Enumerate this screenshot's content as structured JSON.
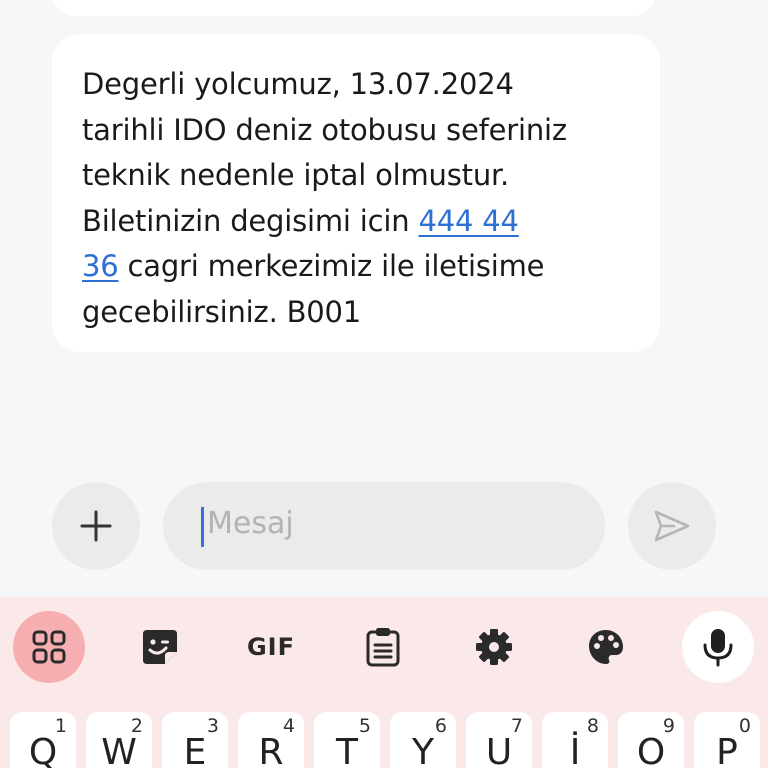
{
  "message": {
    "lines": [
      "Degerli yolcumuz, 13.07.2024",
      "tarihli IDO deniz otobusu seferiniz",
      "teknik nedenle iptal olmustur.",
      "Biletinizin degisimi icin ",
      "444 44",
      "36",
      " cagri merkezimiz ile iletisime",
      "gecebilirsiniz. B001"
    ]
  },
  "compose": {
    "placeholder": "Mesaj",
    "add_icon": "plus-icon",
    "send_icon": "send-icon"
  },
  "keyboard": {
    "toolbar": [
      {
        "name": "apps-grid-icon"
      },
      {
        "name": "sticker-icon"
      },
      {
        "name": "gif-button",
        "label": "GIF"
      },
      {
        "name": "clipboard-icon"
      },
      {
        "name": "settings-gear-icon"
      },
      {
        "name": "palette-icon"
      },
      {
        "name": "microphone-icon"
      }
    ],
    "keys": [
      {
        "letter": "Q",
        "num": "1"
      },
      {
        "letter": "W",
        "num": "2"
      },
      {
        "letter": "E",
        "num": "3"
      },
      {
        "letter": "R",
        "num": "4"
      },
      {
        "letter": "T",
        "num": "5"
      },
      {
        "letter": "Y",
        "num": "6"
      },
      {
        "letter": "U",
        "num": "7"
      },
      {
        "letter": "İ",
        "num": "8"
      },
      {
        "letter": "O",
        "num": "9"
      },
      {
        "letter": "P",
        "num": "0"
      }
    ]
  },
  "colors": {
    "link": "#2d6fd2",
    "caret": "#3a6fe0",
    "keyboard_bg": "#fbe9ea",
    "apps_highlight": "#f7aeb1"
  }
}
